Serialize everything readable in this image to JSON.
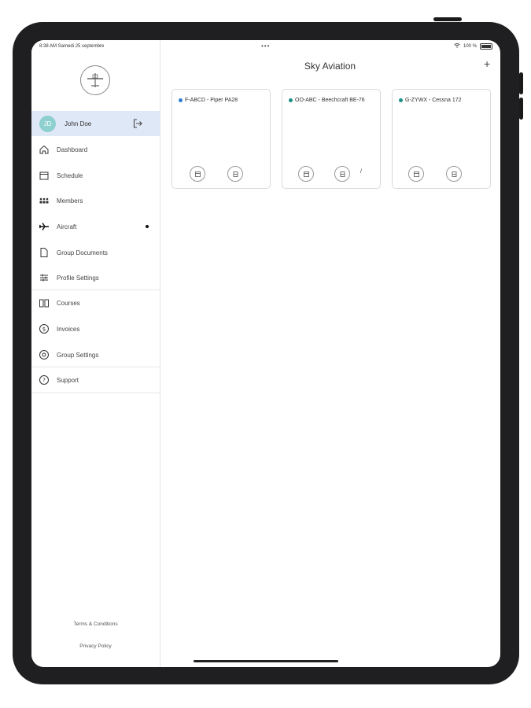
{
  "status_bar": {
    "time": "8:38 AM  Samedi 25 septembre",
    "dots": "•••",
    "battery": "100 %"
  },
  "sidebar": {
    "user": {
      "initials": "JD",
      "name": "John Doe"
    },
    "items": [
      {
        "label": "Dashboard",
        "icon": "home-icon"
      },
      {
        "label": "Schedule",
        "icon": "calendar-icon"
      },
      {
        "label": "Members",
        "icon": "members-icon"
      },
      {
        "label": "Aircraft",
        "icon": "airplane-icon",
        "active_dot": true
      },
      {
        "label": "Group Documents",
        "icon": "document-icon"
      },
      {
        "label": "Profile Settings",
        "icon": "sliders-icon"
      },
      {
        "label": "Courses",
        "icon": "book-icon"
      },
      {
        "label": "Invoices",
        "icon": "dollar-icon"
      },
      {
        "label": "Group Settings",
        "icon": "settings-icon"
      },
      {
        "label": "Support",
        "icon": "question-icon"
      }
    ],
    "footer": {
      "terms": "Terms & Conditions",
      "privacy": "Privacy Policy"
    }
  },
  "main": {
    "title": "Sky Aviation",
    "add_label": "+",
    "aircraft": [
      {
        "name": "F-ABCD - Piper PA28",
        "status_color": "#2f7fd1",
        "extra": ""
      },
      {
        "name": "OO-ABC - Beechcraft BE-76",
        "status_color": "#1c8f86",
        "extra": "/"
      },
      {
        "name": "G-ZYWX - Cessna 172",
        "status_color": "#1c8f86",
        "extra": ""
      }
    ]
  }
}
